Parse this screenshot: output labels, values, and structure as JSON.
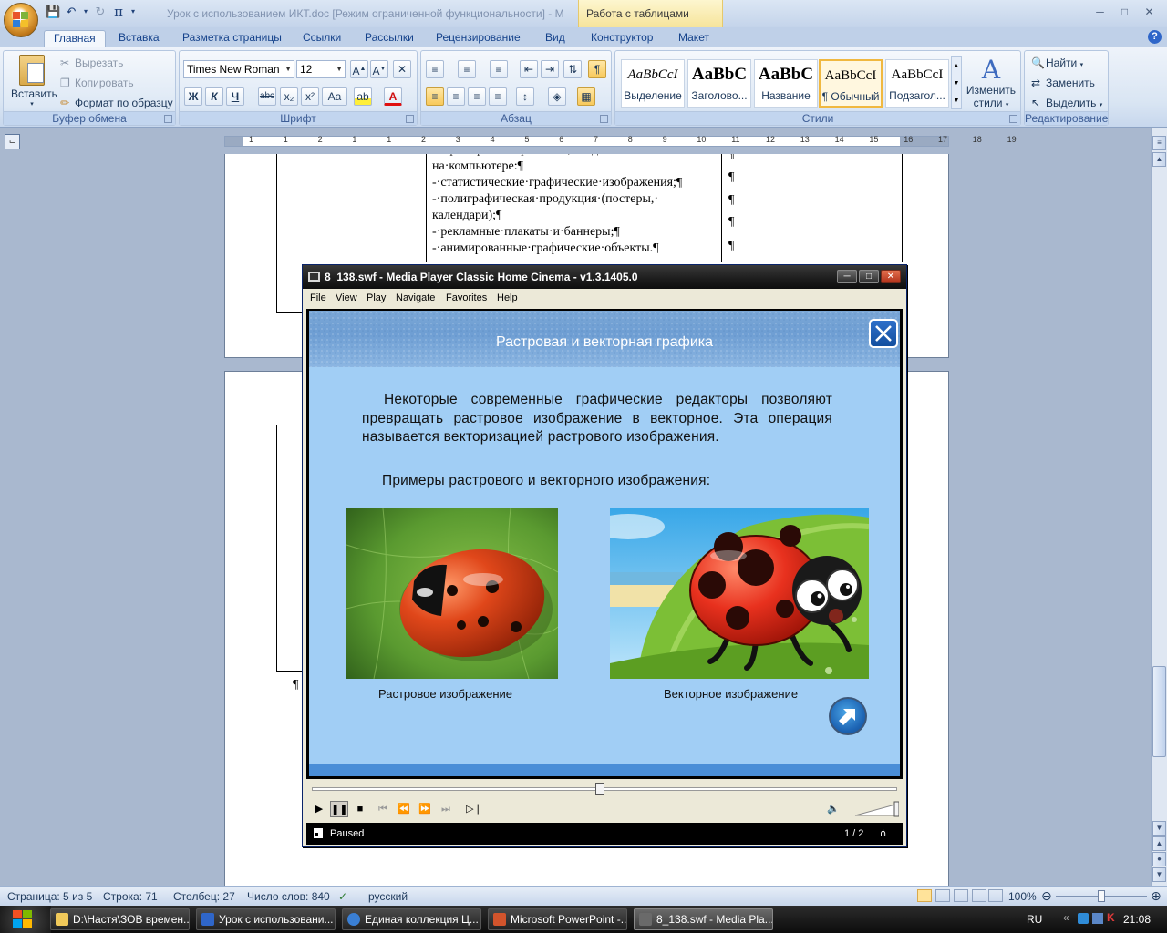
{
  "word": {
    "window_title": "Урок с использованием ИКТ.doc [Режим ограниченной функциональности] - M",
    "context_tab_group": "Работа с таблицами",
    "tabs": [
      "Главная",
      "Вставка",
      "Разметка страницы",
      "Ссылки",
      "Рассылки",
      "Рецензирование",
      "Вид",
      "Конструктор",
      "Макет"
    ],
    "active_tab": "Главная",
    "clipboard": {
      "paste": "Вставить",
      "cut": "Вырезать",
      "copy": "Копировать",
      "format_painter": "Формат по образцу",
      "label": "Буфер обмена"
    },
    "font": {
      "name": "Times New Roman",
      "size": "12",
      "label": "Шрифт",
      "bold": "Ж",
      "italic": "К",
      "underline": "Ч",
      "strike": "abc",
      "subscript": "x₂",
      "superscript": "x²",
      "case": "Aa"
    },
    "paragraph": {
      "label": "Абзац"
    },
    "styles": {
      "label": "Стили",
      "items": [
        {
          "sample": "AaBbCcI",
          "name": "Выделение"
        },
        {
          "sample": "AaBbC",
          "name": "Заголово..."
        },
        {
          "sample": "AaBbC",
          "name": "Название"
        },
        {
          "sample": "AaBbCcI",
          "name": "¶ Обычный"
        },
        {
          "sample": "AaBbCcI",
          "name": "Подзагол..."
        }
      ],
      "change_styles_line1": "Изменить",
      "change_styles_line2": "стили"
    },
    "editing": {
      "label": "Редактирование",
      "find": "Найти",
      "replace": "Заменить",
      "select": "Выделить"
    },
    "ruler_ticks_top": [
      "1",
      "1",
      "2",
      "1",
      "1",
      "2",
      "3",
      "4",
      "5",
      "6",
      "7",
      "8",
      "9",
      "10",
      "11",
      "12",
      "13",
      "14",
      "15",
      "16",
      "17",
      "18",
      "19"
    ],
    "document_lines": [
      "на·компьютере:¶",
      "-·статистические·графические·изображения;¶",
      "-·полиграфическая·продукция·(постеры,·",
      "календари);¶",
      "-·рекламные·плакаты·и·баннеры;¶",
      "-·анимированные·графические·объекты.¶"
    ],
    "status": {
      "page": "Страница: 5 из 5",
      "line": "Строка: 71",
      "column": "Столбец: 27",
      "words": "Число слов: 840",
      "language": "русский",
      "zoom": "100%"
    }
  },
  "mpc": {
    "title": "8_138.swf - Media Player Classic Home Cinema - v1.3.1405.0",
    "menu": [
      "File",
      "View",
      "Play",
      "Navigate",
      "Favorites",
      "Help"
    ],
    "status": "Paused",
    "counter": "1 / 2",
    "seek_fraction": 0.5,
    "volume_fraction": 1.0
  },
  "slide": {
    "title": "Растровая и векторная графика",
    "body": "Некоторые современные графические редакторы позволяют превращать растровое изображение в векторное. Эта операция называется векторизацией растрового изображения.",
    "subtitle": "Примеры растрового и векторного изображения:",
    "raster_caption": "Растровое изображение",
    "vector_caption": "Векторное изображение"
  },
  "taskbar": {
    "tasks": [
      "D:\\Настя\\ЗОВ времен...",
      "Урок с использовани...",
      "Единая коллекция Ц...",
      "Microsoft PowerPoint -...",
      "8_138.swf - Media Pla..."
    ],
    "language": "RU",
    "time": "21:08"
  }
}
